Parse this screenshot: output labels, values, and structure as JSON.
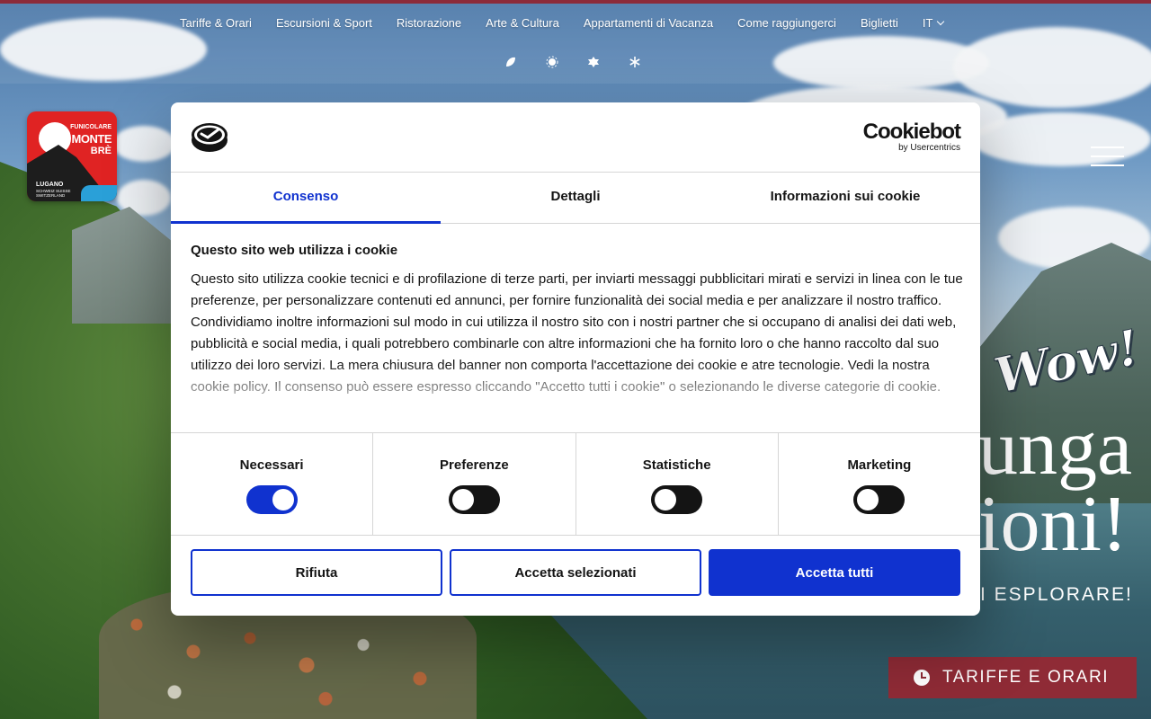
{
  "nav": {
    "items": [
      "Tariffe & Orari",
      "Escursioni & Sport",
      "Ristorazione",
      "Arte & Cultura",
      "Appartamenti di Vacanza",
      "Come raggiungerci",
      "Biglietti"
    ],
    "language": "IT",
    "season_icons": [
      "spring-leaf-icon",
      "summer-sun-icon",
      "autumn-leaf-icon",
      "winter-snowflake-icon"
    ]
  },
  "logo": {
    "line1": "FUNICOLARE",
    "line2": "MONTE",
    "line3": "BRÈ",
    "line4": "LUGANO",
    "line5": "SCHWEIZ SUISSE",
    "line6": "SWITZERLAND"
  },
  "hero": {
    "wow": "Wow!",
    "line1": "unga",
    "line2": "ioni!",
    "sub": "I ESPLORARE!"
  },
  "tariffe_button": {
    "label": "TARIFFE E ORARI"
  },
  "cookie": {
    "brand": "Cookiebot",
    "brand_sub": "by Usercentrics",
    "tabs": [
      "Consenso",
      "Dettagli",
      "Informazioni sui cookie"
    ],
    "active_tab": "Consenso",
    "title": "Questo sito web utilizza i cookie",
    "text": "Questo sito utilizza cookie tecnici e di profilazione di terze parti, per inviarti messaggi pubblicitari mirati e servizi in linea con le tue preferenze, per personalizzare contenuti ed annunci, per fornire funzionalità dei social media e per analizzare il nostro traffico. Condividiamo inoltre informazioni sul modo in cui utilizza il nostro sito con i nostri partner che si occupano di analisi dei dati web, pubblicità e social media, i quali potrebbero combinarle con altre informazioni che ha fornito loro o che hanno raccolto dal suo utilizzo dei loro servizi. La mera chiusura del banner non comporta l'accettazione dei cookie e atre tecnologie. Vedi la nostra cookie policy. Il consenso può essere espresso cliccando \"Accetto tutti i cookie\" o selezionando le diverse categorie di cookie.",
    "toggles": [
      {
        "label": "Necessari",
        "on": true
      },
      {
        "label": "Preferenze",
        "on": false
      },
      {
        "label": "Statistiche",
        "on": false
      },
      {
        "label": "Marketing",
        "on": false
      }
    ],
    "buttons": {
      "reject": "Rifiuta",
      "accept_selected": "Accetta selezionati",
      "accept_all": "Accetta tutti"
    },
    "colors": {
      "accent": "#1032cf",
      "brand_red": "#8f2b36"
    }
  }
}
